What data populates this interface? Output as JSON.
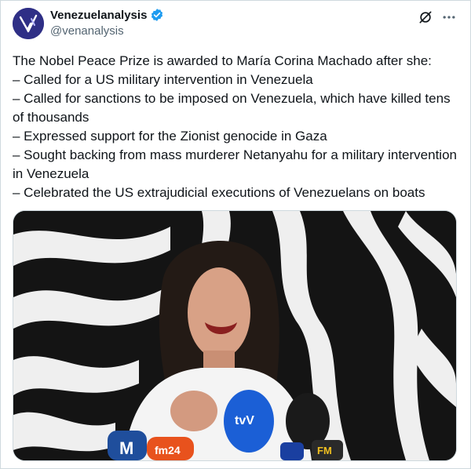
{
  "account": {
    "display_name": "Venezuelanalysis",
    "handle": "@venanalysis",
    "verified": true,
    "avatar_color": "#2f2f86"
  },
  "post": {
    "lines": [
      "The Nobel Peace Prize is awarded to María Corina Machado after she:",
      "– Called for a US military intervention in Venezuela",
      "– Called for sanctions to be imposed on Venezuela, which have killed tens of thousands",
      "– Expressed support for the Zionist genocide in Gaza",
      "– Sought backing from mass murderer Netanyahu for a military intervention in Venezuela",
      "– Celebrated the US extrajudicial executions of Venezuelans on boats"
    ]
  },
  "media": {
    "microphones": [
      {
        "label": "M",
        "color": "#1f4e9c"
      },
      {
        "label": "fm24",
        "color": "#e8521d"
      },
      {
        "label": "tvV",
        "color": "#1b5fd6"
      },
      {
        "label": "FM",
        "color": "#1a1a1a"
      }
    ]
  },
  "icons": {
    "verified": "verified-badge-icon",
    "grok": "grok-icon",
    "more": "more-icon"
  },
  "colors": {
    "text": "#0f1419",
    "secondary": "#536471",
    "verified": "#1d9bf0"
  }
}
